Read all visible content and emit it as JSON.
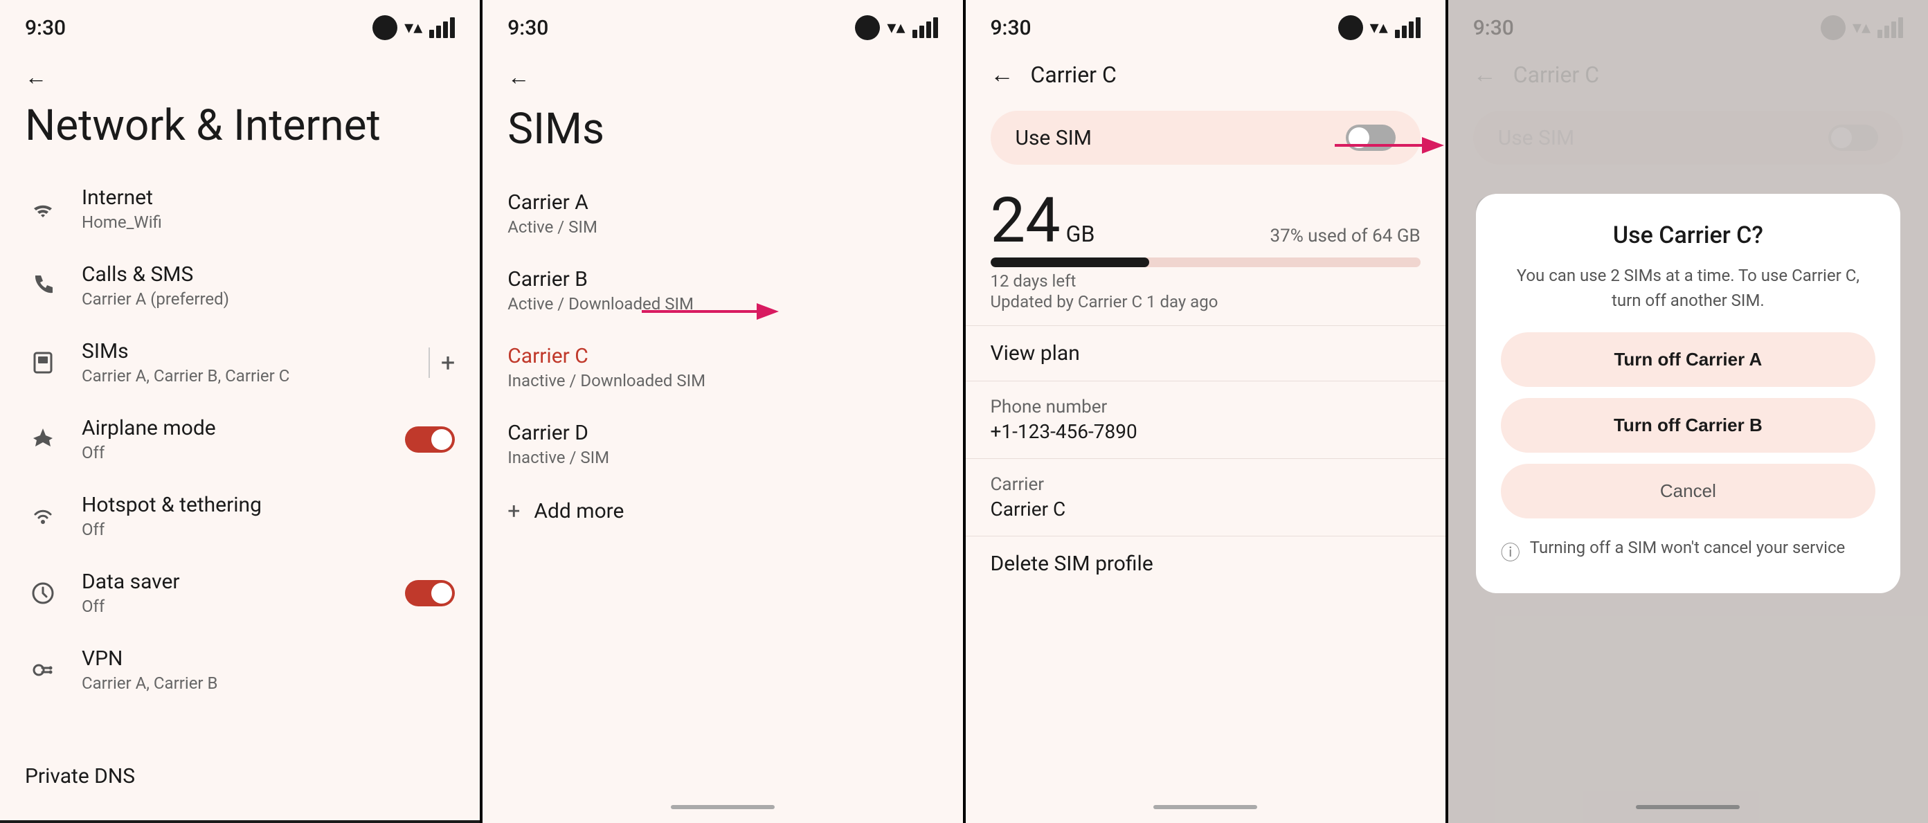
{
  "screens": {
    "screen1": {
      "status_time": "9:30",
      "back_visible": true,
      "title": "Network & Internet",
      "menu_items": [
        {
          "id": "internet",
          "icon": "wifi",
          "label": "Internet",
          "sublabel": "Home_Wifi",
          "has_toggle": false,
          "toggle_on": false
        },
        {
          "id": "calls_sms",
          "icon": "phone",
          "label": "Calls & SMS",
          "sublabel": "Carrier A (preferred)",
          "has_toggle": false,
          "toggle_on": false
        },
        {
          "id": "sims",
          "icon": "sim",
          "label": "SIMs",
          "sublabel": "Carrier A, Carrier B, Carrier C",
          "has_toggle": false,
          "has_divider_add": true
        },
        {
          "id": "airplane",
          "icon": "airplane",
          "label": "Airplane mode",
          "sublabel": "Off",
          "has_toggle": true,
          "toggle_on": true
        },
        {
          "id": "hotspot",
          "icon": "hotspot",
          "label": "Hotspot & tethering",
          "sublabel": "Off",
          "has_toggle": false
        },
        {
          "id": "datasaver",
          "icon": "datasaver",
          "label": "Data saver",
          "sublabel": "Off",
          "has_toggle": true,
          "toggle_on": true
        },
        {
          "id": "vpn",
          "icon": "vpn",
          "label": "VPN",
          "sublabel": "Carrier A, Carrier B",
          "has_toggle": false
        }
      ],
      "bottom_item": "Private DNS"
    },
    "screen2": {
      "status_time": "9:30",
      "title": "SIMs",
      "sims": [
        {
          "id": "carrier_a",
          "name": "Carrier A",
          "status": "Active / SIM",
          "highlighted": false
        },
        {
          "id": "carrier_b",
          "name": "Carrier B",
          "status": "Active / Downloaded SIM",
          "highlighted": false
        },
        {
          "id": "carrier_c",
          "name": "Carrier C",
          "status": "Inactive / Downloaded SIM",
          "highlighted": true
        },
        {
          "id": "carrier_d",
          "name": "Carrier D",
          "status": "Inactive / SIM",
          "highlighted": false
        }
      ],
      "add_more_label": "Add more"
    },
    "screen3": {
      "status_time": "9:30",
      "back_label": "←",
      "title": "Carrier C",
      "use_sim_label": "Use SIM",
      "use_sim_on": false,
      "data_gb": "24",
      "data_unit": "GB",
      "data_percent_text": "37% used of 64 GB",
      "data_percent": 37,
      "data_days": "12 days left",
      "data_updated": "Updated by Carrier C 1 day ago",
      "view_plan": "View plan",
      "phone_number_label": "Phone number",
      "phone_number_value": "+1-123-456-7890",
      "carrier_label": "Carrier",
      "carrier_value": "Carrier C",
      "delete_label": "Delete SIM profile"
    },
    "screen4": {
      "status_time": "9:30",
      "back_label": "←",
      "title": "Carrier C",
      "use_sim_label": "Use SIM",
      "dialog": {
        "title": "Use Carrier C?",
        "description": "You can use 2 SIMs at a time. To use Carrier C, turn off another SIM.",
        "btn1": "Turn off Carrier A",
        "btn2": "Turn off Carrier B",
        "btn3": "Cancel",
        "info_text": "Turning off a SIM won't cancel your service"
      }
    }
  }
}
